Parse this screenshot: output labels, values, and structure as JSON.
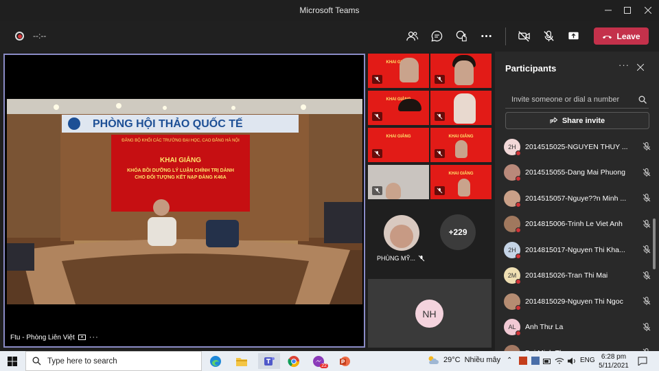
{
  "window": {
    "title": "Microsoft Teams"
  },
  "toolbar": {
    "timer": "--:--",
    "leave_label": "Leave"
  },
  "stage": {
    "caption": "Ftu - Phòng Liên Việt",
    "room_sign": "PHÒNG HỘI THẢO QUỐC TẾ",
    "banner_top": "ĐẢNG BỘ KHỐI CÁC TRƯỜNG ĐẠI HỌC, CAO ĐẲNG HÀ NỘI",
    "banner_title": "KHAI GIẢNG",
    "banner_line1": "KHÓA BỒI DƯỠNG LÝ LUẬN CHÍNH TRỊ DÀNH",
    "banner_line2": "CHO ĐỐI TƯỢNG KẾT NẠP ĐẢNG K46A"
  },
  "tiles": {
    "banner_small": "KHAI GIẢNG",
    "phung_name": "PHÙNG MỸ...",
    "overflow_count": "+229",
    "nh_initials": "NH"
  },
  "panel": {
    "title": "Participants",
    "invite_placeholder": "Invite someone or dial a number",
    "share_label": "Share invite",
    "participants": [
      {
        "initials": "2H",
        "name": "2014515025-NGUYEN THUY ...",
        "color": "#f2d8d8"
      },
      {
        "initials": "",
        "name": "2014515055-Dang Mai Phuong",
        "color": "#b9897a"
      },
      {
        "initials": "",
        "name": "2014515057-Nguye??n Minh ...",
        "color": "#caa088"
      },
      {
        "initials": "",
        "name": "2014815006-Trinh Le Viet Anh",
        "color": "#a0785e"
      },
      {
        "initials": "2H",
        "name": "2014815017-Nguyen Thi Kha...",
        "color": "#c5d4e6"
      },
      {
        "initials": "2M",
        "name": "2014815026-Tran Thi Mai",
        "color": "#efdfb3"
      },
      {
        "initials": "",
        "name": "2014815029-Nguyen Thi Ngoc",
        "color": "#b58c72"
      },
      {
        "initials": "AL",
        "name": "Anh Thư La",
        "color": "#f1c9d4"
      },
      {
        "initials": "",
        "name": "Bui Minh Th...",
        "color": "#a37862"
      }
    ]
  },
  "taskbar": {
    "search_placeholder": "Type here to search",
    "weather_temp": "29°C",
    "weather_text": "Nhiều mây",
    "lang": "ENG",
    "time": "6:28 pm",
    "date": "5/11/2021",
    "chrome_badge": "22"
  }
}
